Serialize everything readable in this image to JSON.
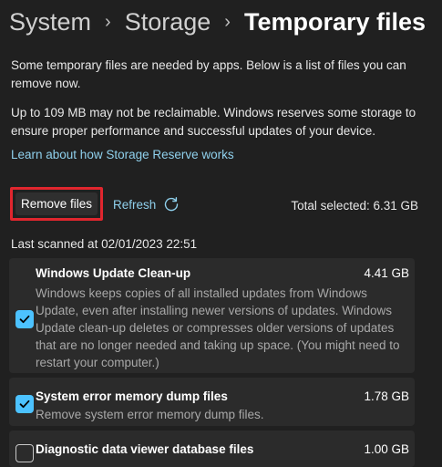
{
  "breadcrumb": {
    "items": [
      "System",
      "Storage",
      "Temporary files"
    ]
  },
  "intro": {
    "p1": "Some temporary files are needed by apps. Below is a list of files you can remove now.",
    "p2": "Up to 109 MB may not be reclaimable. Windows reserves some storage to ensure proper performance and successful updates of your device.",
    "link": "Learn about how Storage Reserve works"
  },
  "actions": {
    "remove_label": "Remove files",
    "refresh_label": "Refresh",
    "total_selected": "Total selected: 6.31 GB"
  },
  "last_scanned": "Last scanned at 02/01/2023 22:51",
  "items": [
    {
      "title": "Windows Update Clean-up",
      "size": "4.41 GB",
      "checked": true,
      "description": "Windows keeps copies of all installed updates from Windows Update, even after installing newer versions of updates. Windows Update clean-up deletes or compresses older versions of updates that are no longer needed and taking up space. (You might need to restart your computer.)"
    },
    {
      "title": "System error memory dump files",
      "size": "1.78 GB",
      "checked": true,
      "description": "Remove system error memory dump files."
    },
    {
      "title": "Diagnostic data viewer database files",
      "size": "1.00 GB",
      "checked": false,
      "description": ""
    }
  ],
  "colors": {
    "background": "#202020",
    "card": "#2b2b2b",
    "accent": "#4cc2ff",
    "link": "#8fd0ec",
    "highlight_border": "#e0262e"
  },
  "icons": {
    "separator": "chevron-right-icon",
    "refresh": "refresh-icon",
    "checkmark": "checkmark-icon"
  }
}
